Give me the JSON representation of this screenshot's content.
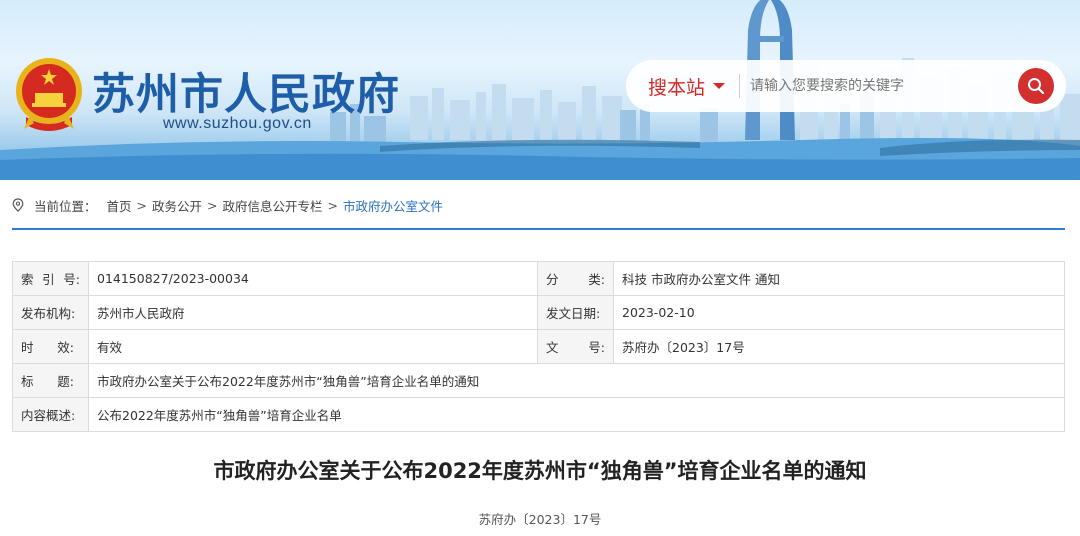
{
  "header": {
    "site_name": "苏州市人民政府",
    "site_url": "www.suzhou.gov.cn",
    "emblem_icon": "national-emblem-icon"
  },
  "search": {
    "scope_label": "搜本站",
    "placeholder": "请输入您要搜索的关键字",
    "button_icon": "search-icon"
  },
  "breadcrumb": {
    "label": "当前位置：",
    "items": [
      "首页",
      "政务公开",
      "政府信息公开专栏",
      "市政府办公室文件"
    ],
    "separator": ">"
  },
  "info": {
    "index_label": [
      "索",
      "引",
      "号:"
    ],
    "index_value": "014150827/2023-00034",
    "category_label": [
      "分",
      "类:"
    ],
    "category_value": "科技 市政府办公室文件 通知",
    "publisher_label": "发布机构:",
    "publisher_value": "苏州市人民政府",
    "date_label": "发文日期:",
    "date_value": "2023-02-10",
    "validity_label": [
      "时",
      "效:"
    ],
    "validity_value": "有效",
    "docno_label": [
      "文",
      "号:"
    ],
    "docno_value": "苏府办〔2023〕17号",
    "title_label": [
      "标",
      "题:"
    ],
    "title_value": "市政府办公室关于公布2022年度苏州市“独角兽”培育企业名单的通知",
    "summary_label": "内容概述:",
    "summary_value": "公布2022年度苏州市“独角兽”培育企业名单"
  },
  "document": {
    "title": "市政府办公室关于公布2022年度苏州市“独角兽”培育企业名单的通知",
    "number": "苏府办〔2023〕17号"
  },
  "colors": {
    "brand_blue": "#1e5ea8",
    "accent_red": "#d32f2f",
    "link_blue": "#2a6fc0",
    "rule_blue": "#2d7ed0"
  }
}
